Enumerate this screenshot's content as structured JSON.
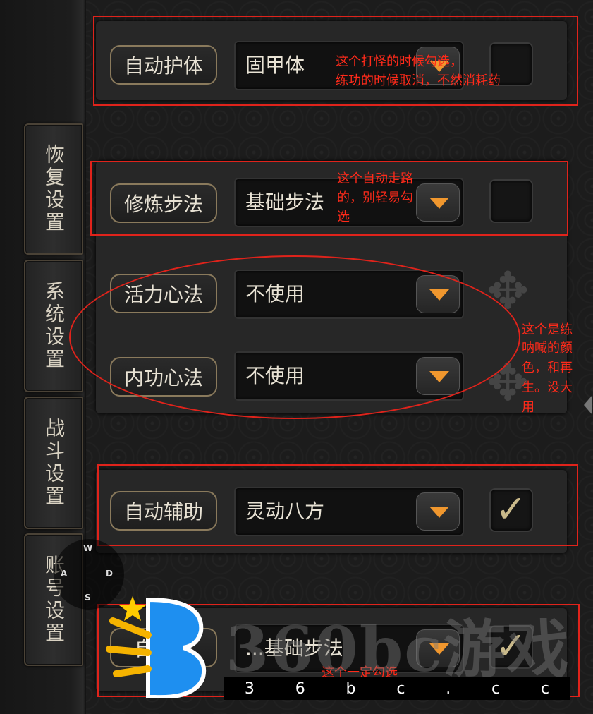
{
  "side_tabs": [
    {
      "label": "恢复设置"
    },
    {
      "label": "系统设置"
    },
    {
      "label": "战斗设置"
    },
    {
      "label": "账号设置"
    }
  ],
  "rows": [
    {
      "label": "自动护体",
      "value": "固甲体",
      "checked": false
    },
    {
      "label": "修炼步法",
      "value": "基础步法",
      "checked": false
    },
    {
      "label": "活力心法",
      "value": "不使用"
    },
    {
      "label": "内功心法",
      "value": "不使用"
    },
    {
      "label": "自动辅助",
      "value": "灵动八方",
      "checked": true
    },
    {
      "label": "自动...",
      "value": "...基础步法",
      "checked": true
    }
  ],
  "annotations": {
    "a1_line1": "这个打怪的时候勾选，",
    "a1_line2": "练功的时候取消，不然消耗药",
    "a2_line1": "这个自动走路",
    "a2_line2": "的，别轻易勾",
    "a2_line3": "选",
    "a3_line1": "这个是练",
    "a3_line2": "呐喊的颜",
    "a3_line3": "色，和再",
    "a3_line4": "生。没大",
    "a3_line5": "用",
    "a4": "这个一定勾选"
  },
  "compass": {
    "n": "W",
    "w": "A",
    "e": "D",
    "s": "S"
  },
  "watermark": {
    "text": "360bc游戏",
    "chars": [
      "3",
      "6",
      "b",
      "c",
      ".",
      "c",
      "c"
    ]
  },
  "colors": {
    "accent": "#f0972e",
    "annotation": "#e0231b",
    "label_border": "#8a7a5c"
  }
}
